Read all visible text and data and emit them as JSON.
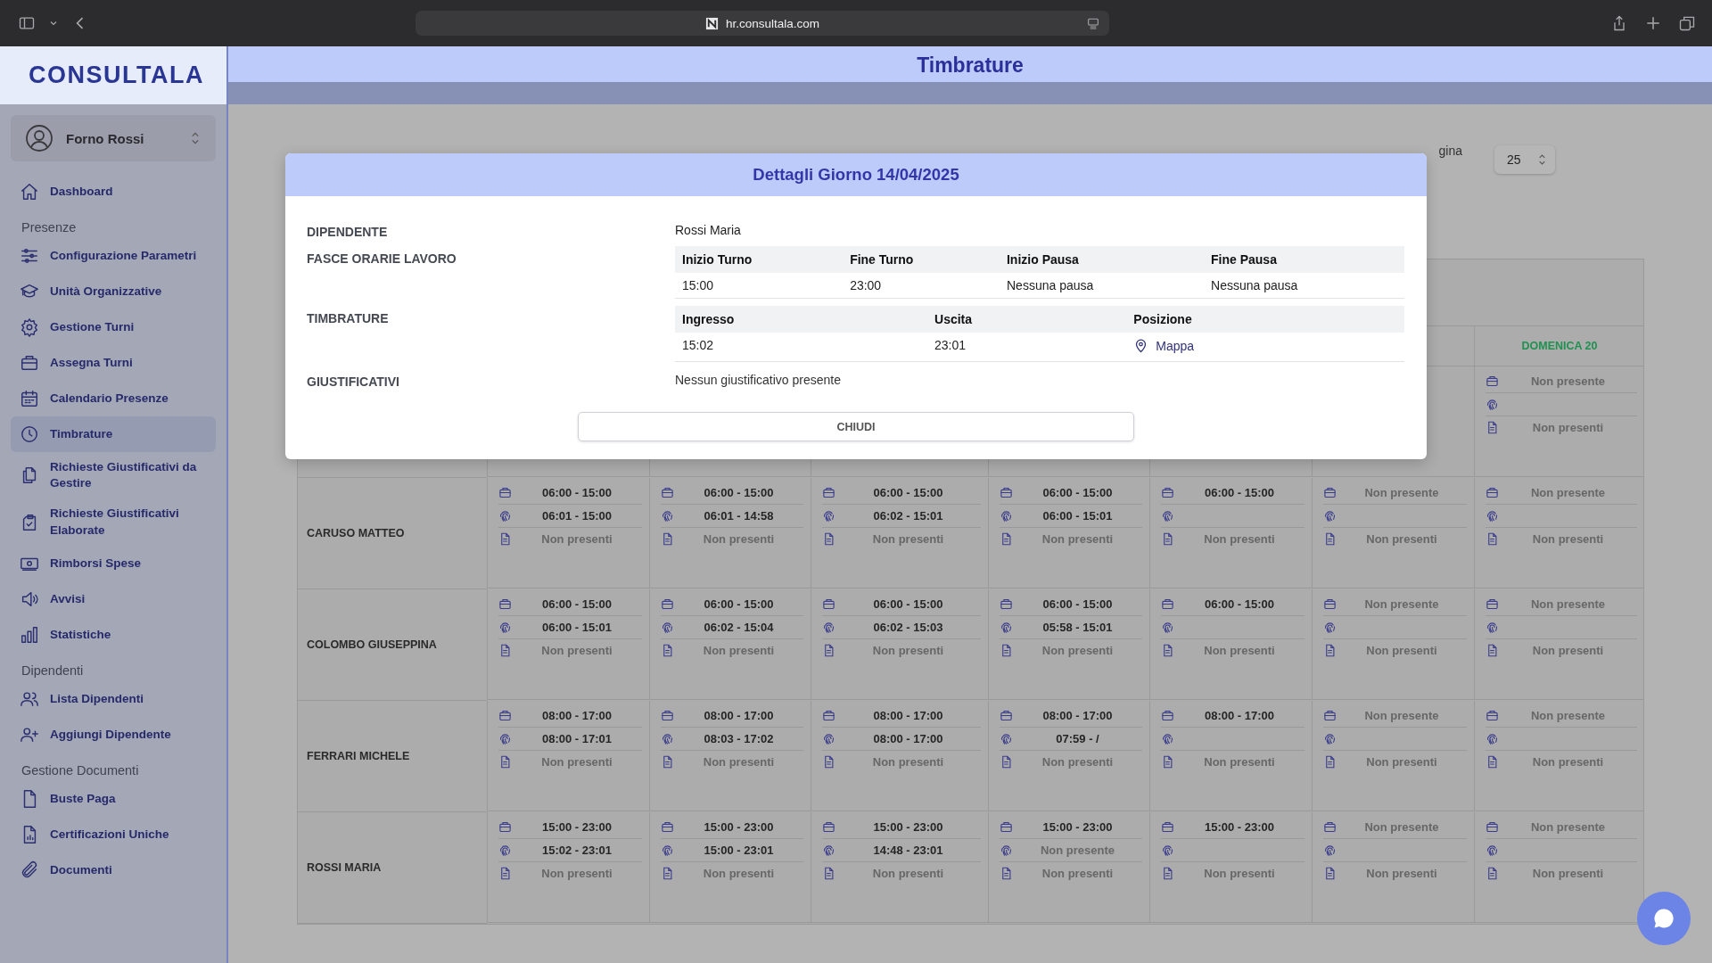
{
  "browser": {
    "url": "hr.consultala.com"
  },
  "sidebar": {
    "logo": "CONSULTALA",
    "account": {
      "name": "Forno Rossi"
    },
    "nav": [
      {
        "kind": "link",
        "label": "Dashboard",
        "selected": false
      },
      {
        "kind": "heading",
        "label": "Presenze"
      },
      {
        "kind": "link",
        "label": "Configurazione Parametri",
        "selected": false
      },
      {
        "kind": "link",
        "label": "Unità Organizzative",
        "selected": false
      },
      {
        "kind": "link",
        "label": "Gestione Turni",
        "selected": false
      },
      {
        "kind": "link",
        "label": "Assegna Turni",
        "selected": false
      },
      {
        "kind": "link",
        "label": "Calendario Presenze",
        "selected": false
      },
      {
        "kind": "link",
        "label": "Timbrature",
        "selected": true
      },
      {
        "kind": "link",
        "label": "Richieste Giustificativi da Gestire",
        "selected": false
      },
      {
        "kind": "link",
        "label": "Richieste Giustificativi Elaborate",
        "selected": false
      },
      {
        "kind": "link",
        "label": "Rimborsi Spese",
        "selected": false
      },
      {
        "kind": "link",
        "label": "Avvisi",
        "selected": false
      },
      {
        "kind": "link",
        "label": "Statistiche",
        "selected": false
      },
      {
        "kind": "heading",
        "label": "Dipendenti"
      },
      {
        "kind": "link",
        "label": "Lista Dipendenti",
        "selected": false
      },
      {
        "kind": "link",
        "label": "Aggiungi Dipendente",
        "selected": false
      },
      {
        "kind": "heading",
        "label": "Gestione Documenti"
      },
      {
        "kind": "link",
        "label": "Buste Paga",
        "selected": false
      },
      {
        "kind": "link",
        "label": "Certificazioni Uniche",
        "selected": false
      },
      {
        "kind": "link",
        "label": "Documenti",
        "selected": false
      }
    ]
  },
  "page": {
    "title": "Timbrature",
    "rows_per_page": {
      "label": "gina",
      "value": "25"
    }
  },
  "table": {
    "day_headers": [
      "DOMENICA 20"
    ],
    "rows": [
      {
        "employee": "",
        "cells": [
          "",
          "",
          "",
          "",
          "",
          "",
          {
            "lines": [
              {
                "kind": "shift",
                "text": "Non presente",
                "muted": true
              },
              {
                "kind": "punch"
              },
              {
                "kind": "justification",
                "text": "Non presenti",
                "muted": true
              }
            ]
          }
        ]
      },
      {
        "employee": "CARUSO MATTEO",
        "cells": [
          {
            "lines": [
              {
                "kind": "shift",
                "text": "06:00 - 15:00",
                "muted": false
              },
              {
                "kind": "punch",
                "text": "06:01 - 15:00",
                "muted": false
              },
              {
                "kind": "justification",
                "text": "Non presenti",
                "muted": true
              }
            ]
          },
          {
            "lines": [
              {
                "kind": "shift",
                "text": "06:00 - 15:00",
                "muted": false
              },
              {
                "kind": "punch",
                "text": "06:01 - 14:58",
                "muted": false
              },
              {
                "kind": "justification",
                "text": "Non presenti",
                "muted": true
              }
            ]
          },
          {
            "lines": [
              {
                "kind": "shift",
                "text": "06:00 - 15:00",
                "muted": false
              },
              {
                "kind": "punch",
                "text": "06:02 - 15:01",
                "muted": false
              },
              {
                "kind": "justification",
                "text": "Non presenti",
                "muted": true
              }
            ]
          },
          {
            "lines": [
              {
                "kind": "shift",
                "text": "06:00 - 15:00",
                "muted": false
              },
              {
                "kind": "punch",
                "text": "06:00 - 15:01",
                "muted": false
              },
              {
                "kind": "justification",
                "text": "Non presenti",
                "muted": true
              }
            ]
          },
          {
            "lines": [
              {
                "kind": "shift",
                "text": "06:00 - 15:00",
                "muted": false
              },
              {
                "kind": "punch"
              },
              {
                "kind": "justification",
                "text": "Non presenti",
                "muted": true
              }
            ]
          },
          {
            "lines": [
              {
                "kind": "shift",
                "text": "Non presente",
                "muted": true
              },
              {
                "kind": "punch"
              },
              {
                "kind": "justification",
                "text": "Non presenti",
                "muted": true
              }
            ]
          },
          {
            "lines": [
              {
                "kind": "shift",
                "text": "Non presente",
                "muted": true
              },
              {
                "kind": "punch"
              },
              {
                "kind": "justification",
                "text": "Non presenti",
                "muted": true
              }
            ]
          }
        ]
      },
      {
        "employee": "COLOMBO GIUSEPPINA",
        "cells": [
          {
            "lines": [
              {
                "kind": "shift",
                "text": "06:00 - 15:00",
                "muted": false
              },
              {
                "kind": "punch",
                "text": "06:00 - 15:01",
                "muted": false
              },
              {
                "kind": "justification",
                "text": "Non presenti",
                "muted": true
              }
            ]
          },
          {
            "lines": [
              {
                "kind": "shift",
                "text": "06:00 - 15:00",
                "muted": false
              },
              {
                "kind": "punch",
                "text": "06:02 - 15:04",
                "muted": false
              },
              {
                "kind": "justification",
                "text": "Non presenti",
                "muted": true
              }
            ]
          },
          {
            "lines": [
              {
                "kind": "shift",
                "text": "06:00 - 15:00",
                "muted": false
              },
              {
                "kind": "punch",
                "text": "06:02 - 15:03",
                "muted": false
              },
              {
                "kind": "justification",
                "text": "Non presenti",
                "muted": true
              }
            ]
          },
          {
            "lines": [
              {
                "kind": "shift",
                "text": "06:00 - 15:00",
                "muted": false
              },
              {
                "kind": "punch",
                "text": "05:58 - 15:01",
                "muted": false
              },
              {
                "kind": "justification",
                "text": "Non presenti",
                "muted": true
              }
            ]
          },
          {
            "lines": [
              {
                "kind": "shift",
                "text": "06:00 - 15:00",
                "muted": false
              },
              {
                "kind": "punch"
              },
              {
                "kind": "justification",
                "text": "Non presenti",
                "muted": true
              }
            ]
          },
          {
            "lines": [
              {
                "kind": "shift",
                "text": "Non presente",
                "muted": true
              },
              {
                "kind": "punch"
              },
              {
                "kind": "justification",
                "text": "Non presenti",
                "muted": true
              }
            ]
          },
          {
            "lines": [
              {
                "kind": "shift",
                "text": "Non presente",
                "muted": true
              },
              {
                "kind": "punch"
              },
              {
                "kind": "justification",
                "text": "Non presenti",
                "muted": true
              }
            ]
          }
        ]
      },
      {
        "employee": "FERRARI MICHELE",
        "cells": [
          {
            "lines": [
              {
                "kind": "shift",
                "text": "08:00 - 17:00",
                "muted": false
              },
              {
                "kind": "punch",
                "text": "08:00 - 17:01",
                "muted": false
              },
              {
                "kind": "justification",
                "text": "Non presenti",
                "muted": true
              }
            ]
          },
          {
            "lines": [
              {
                "kind": "shift",
                "text": "08:00 - 17:00",
                "muted": false
              },
              {
                "kind": "punch",
                "text": "08:03 - 17:02",
                "muted": false
              },
              {
                "kind": "justification",
                "text": "Non presenti",
                "muted": true
              }
            ]
          },
          {
            "lines": [
              {
                "kind": "shift",
                "text": "08:00 - 17:00",
                "muted": false
              },
              {
                "kind": "punch",
                "text": "08:00 - 17:00",
                "muted": false
              },
              {
                "kind": "justification",
                "text": "Non presenti",
                "muted": true
              }
            ]
          },
          {
            "lines": [
              {
                "kind": "shift",
                "text": "08:00 - 17:00",
                "muted": false
              },
              {
                "kind": "punch",
                "text": "07:59 - /",
                "muted": false
              },
              {
                "kind": "justification",
                "text": "Non presenti",
                "muted": true
              }
            ]
          },
          {
            "lines": [
              {
                "kind": "shift",
                "text": "08:00 - 17:00",
                "muted": false
              },
              {
                "kind": "punch"
              },
              {
                "kind": "justification",
                "text": "Non presenti",
                "muted": true
              }
            ]
          },
          {
            "lines": [
              {
                "kind": "shift",
                "text": "Non presente",
                "muted": true
              },
              {
                "kind": "punch"
              },
              {
                "kind": "justification",
                "text": "Non presenti",
                "muted": true
              }
            ]
          },
          {
            "lines": [
              {
                "kind": "shift",
                "text": "Non presente",
                "muted": true
              },
              {
                "kind": "punch"
              },
              {
                "kind": "justification",
                "text": "Non presenti",
                "muted": true
              }
            ]
          }
        ]
      },
      {
        "employee": "ROSSI MARIA",
        "cells": [
          {
            "lines": [
              {
                "kind": "shift",
                "text": "15:00 - 23:00",
                "muted": false
              },
              {
                "kind": "punch",
                "text": "15:02 - 23:01",
                "muted": false
              },
              {
                "kind": "justification",
                "text": "Non presenti",
                "muted": true
              }
            ]
          },
          {
            "lines": [
              {
                "kind": "shift",
                "text": "15:00 - 23:00",
                "muted": false
              },
              {
                "kind": "punch",
                "text": "15:00 - 23:01",
                "muted": false
              },
              {
                "kind": "justification",
                "text": "Non presenti",
                "muted": true
              }
            ]
          },
          {
            "lines": [
              {
                "kind": "shift",
                "text": "15:00 - 23:00",
                "muted": false
              },
              {
                "kind": "punch",
                "text": "14:48 - 23:01",
                "muted": false
              },
              {
                "kind": "justification",
                "text": "Non presenti",
                "muted": true
              }
            ]
          },
          {
            "lines": [
              {
                "kind": "shift",
                "text": "15:00 - 23:00",
                "muted": false
              },
              {
                "kind": "punch",
                "text": "Non presente",
                "muted": true
              },
              {
                "kind": "justification",
                "text": "Non presenti",
                "muted": true
              }
            ]
          },
          {
            "lines": [
              {
                "kind": "shift",
                "text": "15:00 - 23:00",
                "muted": false
              },
              {
                "kind": "punch"
              },
              {
                "kind": "justification",
                "text": "Non presenti",
                "muted": true
              }
            ]
          },
          {
            "lines": [
              {
                "kind": "shift",
                "text": "Non presente",
                "muted": true
              },
              {
                "kind": "punch"
              },
              {
                "kind": "justification",
                "text": "Non presenti",
                "muted": true
              }
            ]
          },
          {
            "lines": [
              {
                "kind": "shift",
                "text": "Non presente",
                "muted": true
              },
              {
                "kind": "punch"
              },
              {
                "kind": "justification",
                "text": "Non presenti",
                "muted": true
              }
            ]
          }
        ]
      }
    ]
  },
  "modal": {
    "title": "Dettagli Giorno 14/04/2025",
    "fields": [
      {
        "kind": "text",
        "label": "DIPENDENTE",
        "value": "Rossi Maria"
      },
      {
        "kind": "table",
        "label": "FASCE ORARIE LAVORO",
        "columns": [
          "Inizio Turno",
          "Fine Turno",
          "Inizio Pausa",
          "Fine Pausa"
        ],
        "rows": [
          [
            {
              "kind": "text",
              "text": "15:00"
            },
            {
              "kind": "text",
              "text": "23:00"
            },
            {
              "kind": "text",
              "text": "Nessuna pausa"
            },
            {
              "kind": "text",
              "text": "Nessuna pausa"
            }
          ]
        ]
      },
      {
        "kind": "table",
        "label": "TIMBRATURE",
        "columns": [
          "Ingresso",
          "Uscita",
          "Posizione"
        ],
        "rows": [
          [
            {
              "kind": "text",
              "text": "15:02"
            },
            {
              "kind": "text",
              "text": "23:01"
            },
            {
              "kind": "link",
              "text": "Mappa"
            }
          ]
        ]
      },
      {
        "kind": "note",
        "label": "GIUSTIFICATIVI",
        "value": "Nessun giustificativo presente"
      }
    ],
    "button": "CHIUDI"
  }
}
